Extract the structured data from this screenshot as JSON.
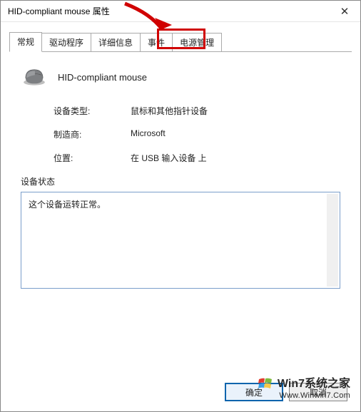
{
  "window": {
    "title": "HID-compliant mouse 属性",
    "close_glyph": "✕"
  },
  "tabs": {
    "t0": "常规",
    "t1": "驱动程序",
    "t2": "详细信息",
    "t3": "事件",
    "t4": "电源管理",
    "active_index": 0,
    "highlighted_index": 4
  },
  "device": {
    "name": "HID-compliant mouse",
    "props": {
      "type_label": "设备类型:",
      "type_value": "鼠标和其他指针设备",
      "mfr_label": "制造商:",
      "mfr_value": "Microsoft",
      "loc_label": "位置:",
      "loc_value": "在 USB 输入设备 上"
    }
  },
  "status": {
    "label": "设备状态",
    "text": "这个设备运转正常。"
  },
  "buttons": {
    "ok": "确定",
    "cancel": "取消"
  },
  "watermark": {
    "line1": "Win7系统之家",
    "line2": "Www.Winwin7.Com"
  }
}
